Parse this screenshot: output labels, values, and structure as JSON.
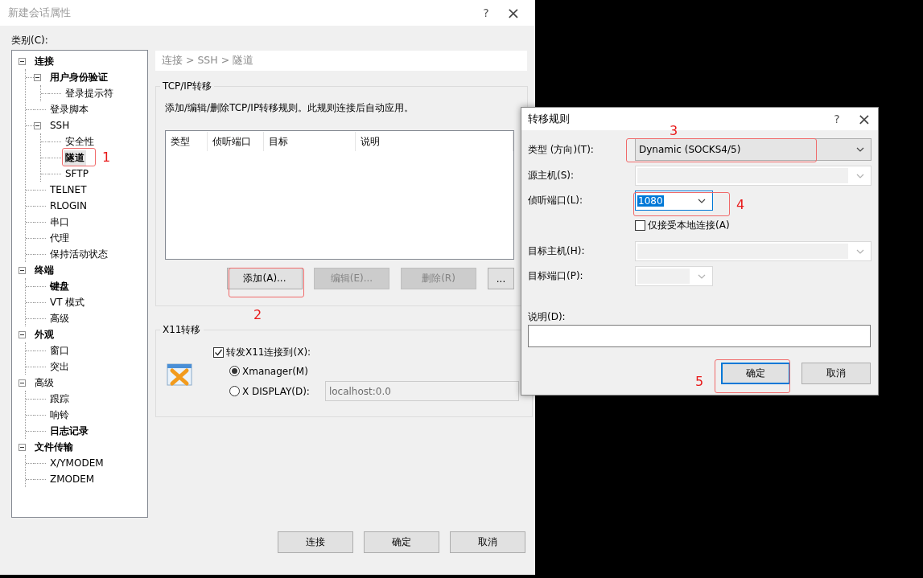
{
  "main_window": {
    "title": "新建会话属性",
    "help": "?",
    "close": "×",
    "category_label": "类别(C):",
    "tree": [
      {
        "label": "连接",
        "bold": true,
        "selected": false,
        "expanded": true,
        "children": [
          {
            "label": "用户身份验证",
            "bold": true,
            "selected": false,
            "expanded": true,
            "children": [
              {
                "label": "登录提示符",
                "bold": false,
                "selected": false
              }
            ]
          },
          {
            "label": "登录脚本",
            "bold": false,
            "selected": false
          },
          {
            "label": "SSH",
            "bold": false,
            "selected": false,
            "expanded": true,
            "children": [
              {
                "label": "安全性",
                "bold": false,
                "selected": false
              },
              {
                "label": "隧道",
                "bold": true,
                "selected": true
              },
              {
                "label": "SFTP",
                "bold": false,
                "selected": false
              }
            ]
          },
          {
            "label": "TELNET",
            "bold": false,
            "selected": false
          },
          {
            "label": "RLOGIN",
            "bold": false,
            "selected": false
          },
          {
            "label": "串口",
            "bold": false,
            "selected": false
          },
          {
            "label": "代理",
            "bold": false,
            "selected": false
          },
          {
            "label": "保持活动状态",
            "bold": false,
            "selected": false
          }
        ]
      },
      {
        "label": "终端",
        "bold": true,
        "selected": false,
        "expanded": true,
        "children": [
          {
            "label": "键盘",
            "bold": true,
            "selected": false
          },
          {
            "label": "VT 模式",
            "bold": false,
            "selected": false
          },
          {
            "label": "高级",
            "bold": false,
            "selected": false
          }
        ]
      },
      {
        "label": "外观",
        "bold": true,
        "selected": false,
        "expanded": true,
        "children": [
          {
            "label": "窗口",
            "bold": false,
            "selected": false
          },
          {
            "label": "突出",
            "bold": false,
            "selected": false
          }
        ]
      },
      {
        "label": "高级",
        "bold": false,
        "selected": false,
        "expanded": true,
        "children": [
          {
            "label": "跟踪",
            "bold": false,
            "selected": false
          },
          {
            "label": "响铃",
            "bold": false,
            "selected": false
          },
          {
            "label": "日志记录",
            "bold": true,
            "selected": false
          }
        ]
      },
      {
        "label": "文件传输",
        "bold": true,
        "selected": false,
        "expanded": true,
        "children": [
          {
            "label": "X/YMODEM",
            "bold": false,
            "selected": false
          },
          {
            "label": "ZMODEM",
            "bold": false,
            "selected": false
          }
        ]
      }
    ],
    "breadcrumb": "连接 > SSH > 隧道",
    "tcpip": {
      "title": "TCP/IP转移",
      "description": "添加/编辑/删除TCP/IP转移规则。此规则连接后自动应用。",
      "columns": [
        "类型",
        "侦听端口",
        "目标",
        "说明"
      ],
      "buttons": [
        {
          "label": "添加(A)...",
          "disabled": false
        },
        {
          "label": "编辑(E)...",
          "disabled": true
        },
        {
          "label": "删除(R)",
          "disabled": true
        },
        {
          "label": "...",
          "disabled": false
        }
      ]
    },
    "x11": {
      "title": "X11转移",
      "forward": {
        "label": "转发X11连接到(X):",
        "checked": true
      },
      "options": [
        {
          "label": "Xmanager(M)",
          "selected": true
        },
        {
          "label": "X DISPLAY(D):",
          "selected": false
        }
      ],
      "display_field": {
        "value": "localhost:0.0",
        "disabled": true
      }
    },
    "buttons": [
      "连接",
      "确定",
      "取消"
    ]
  },
  "rule_dialog": {
    "title": "转移规则",
    "help": "?",
    "close": "×",
    "fields": [
      {
        "kind": "dropdown",
        "label": "类型 (方向)(T):",
        "value": "Dynamic (SOCKS4/5)",
        "disabled": false,
        "focused": false
      },
      {
        "kind": "combo",
        "label": "源主机(S):",
        "disabled": true,
        "focused": false
      },
      {
        "kind": "port",
        "label": "侦听端口(L):",
        "value": "1080",
        "disabled": false,
        "focused": true
      },
      {
        "kind": "check",
        "label": "仅接受本地连接(A)",
        "checked": false
      },
      {
        "kind": "combo",
        "label": "目标主机(H):",
        "disabled": true,
        "focused": false
      },
      {
        "kind": "port",
        "label": "目标端口(P):",
        "disabled": true,
        "focused": false
      }
    ],
    "description": {
      "label": "说明(D):"
    },
    "buttons": [
      {
        "label": "确定",
        "default": true
      },
      {
        "label": "取消",
        "default": false
      }
    ]
  },
  "annotations": [
    {
      "label": "1"
    },
    {
      "label": "2"
    },
    {
      "label": "3"
    },
    {
      "label": "4"
    },
    {
      "label": "5"
    }
  ]
}
